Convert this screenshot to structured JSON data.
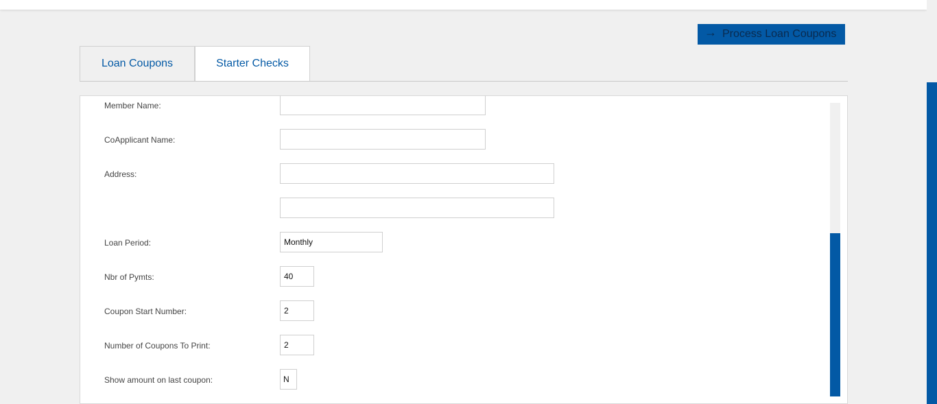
{
  "header": {
    "process_button_label": "Process Loan Coupons",
    "process_button_icon": "arrow-right-icon",
    "accent_color": "#0359a5"
  },
  "tabs": [
    {
      "label": "Loan Coupons",
      "active": true
    },
    {
      "label": "Starter Checks",
      "active": false
    }
  ],
  "form": {
    "member_name": {
      "label": "Member Name:",
      "value": ""
    },
    "coapplicant_name": {
      "label": "CoApplicant Name:",
      "value": ""
    },
    "address": {
      "label": "Address:",
      "line1": "",
      "line2": ""
    },
    "loan_period": {
      "label": "Loan Period:",
      "value": "Monthly"
    },
    "nbr_of_pymts": {
      "label": "Nbr of Pymts:",
      "value": "40"
    },
    "coupon_start_number": {
      "label": "Coupon Start Number:",
      "value": "2"
    },
    "number_of_coupons": {
      "label": "Number of Coupons To Print:",
      "value": "2"
    },
    "show_amount_last_coupon": {
      "label": "Show amount on last coupon:",
      "value": "N"
    }
  }
}
